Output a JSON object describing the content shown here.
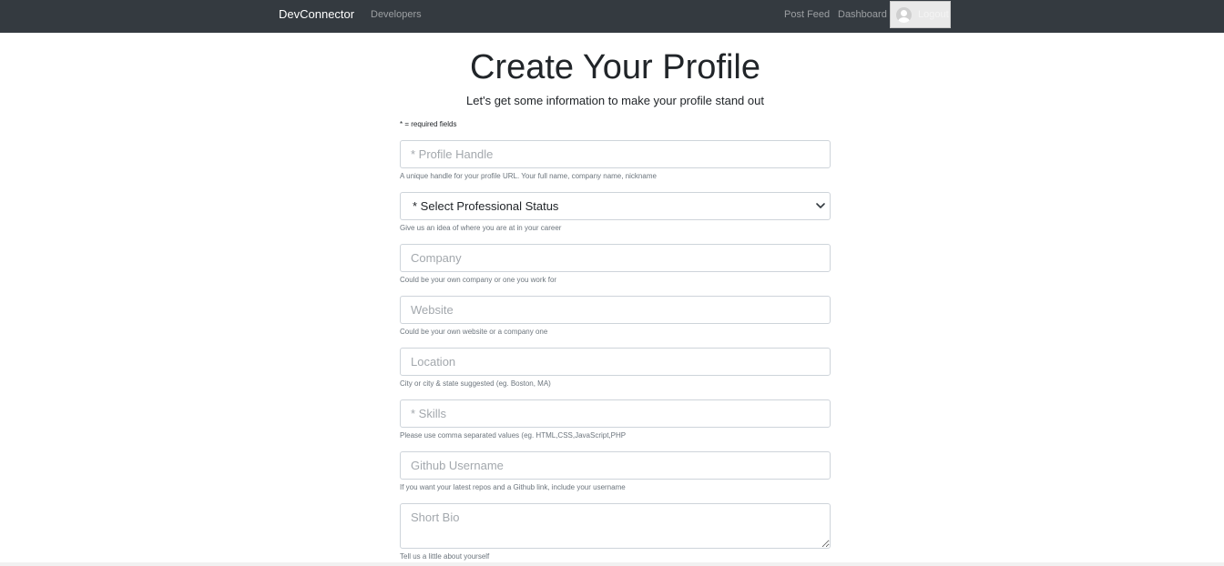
{
  "nav": {
    "brand": "DevConnector",
    "developers": "Developers",
    "post_feed": "Post Feed",
    "dashboard": "Dashboard",
    "logout": "Logout"
  },
  "page": {
    "title": "Create Your Profile",
    "lead": "Let's get some information to make your profile stand out",
    "required_note": "* = required fields"
  },
  "form": {
    "handle": {
      "placeholder": "* Profile Handle",
      "value": "",
      "hint": "A unique handle for your profile URL. Your full name, company name, nickname"
    },
    "status": {
      "selected": "* Select Professional Status",
      "hint": "Give us an idea of where you are at in your career"
    },
    "company": {
      "placeholder": "Company",
      "value": "",
      "hint": "Could be your own company or one you work for"
    },
    "website": {
      "placeholder": "Website",
      "value": "",
      "hint": "Could be your own website or a company one"
    },
    "location": {
      "placeholder": "Location",
      "value": "",
      "hint": "City or city & state suggested (eg. Boston, MA)"
    },
    "skills": {
      "placeholder": "* Skills",
      "value": "",
      "hint": "Please use comma separated values (eg. HTML,CSS,JavaScript,PHP"
    },
    "github": {
      "placeholder": "Github Username",
      "value": "",
      "hint": "If you want your latest repos and a Github link, include your username"
    },
    "bio": {
      "placeholder": "Short Bio",
      "value": "",
      "hint": "Tell us a little about yourself"
    }
  },
  "icons": {
    "avatar": "user-avatar-icon",
    "select_arrow": "chevron-down-icon"
  },
  "colors": {
    "navbar": "#343a40",
    "hint_text": "#6c757d",
    "input_border": "#ced4da"
  }
}
